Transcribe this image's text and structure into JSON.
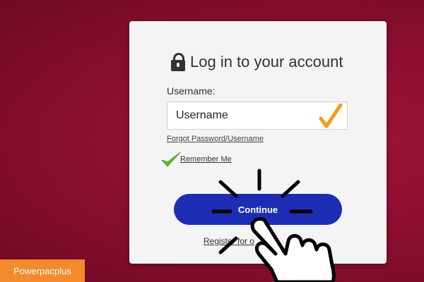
{
  "card": {
    "title": "Log in to your account",
    "title_icon": "lock-icon",
    "username_label": "Username:",
    "username_placeholder": "Username",
    "forgot_link": "Forgot Password/Username",
    "remember_label": "Remember Me",
    "remember_checked": true,
    "continue_label": "Continue",
    "register_link": "Register for o"
  },
  "colors": {
    "background": "#8e0f30",
    "button": "#1c2db3",
    "check_orange": "#f39a1c",
    "check_green": "#6cbf2a",
    "brand_badge": "#f38a2c"
  },
  "overlay": {
    "pointer_icon": "hand-pointer-icon",
    "click_indicator": "click-burst-icon"
  },
  "brand": {
    "label": "Powerpacplus"
  }
}
